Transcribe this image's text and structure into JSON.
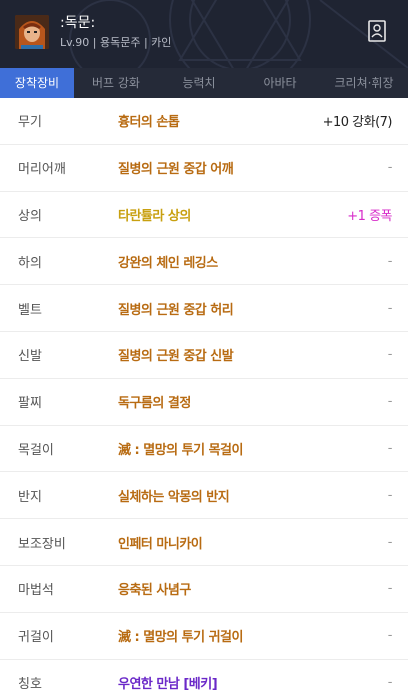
{
  "header": {
    "character_name": ":독문:",
    "character_info": "Lv.90 | 용독문주 | 카인",
    "profile_icon": "profile-card-icon",
    "avatar_icon": "character-portrait"
  },
  "tabs": [
    {
      "label": "장착장비",
      "active": true
    },
    {
      "label": "버프 강화",
      "active": false
    },
    {
      "label": "능력치",
      "active": false
    },
    {
      "label": "아바타",
      "active": false
    },
    {
      "label": "크리쳐·휘장",
      "active": false
    }
  ],
  "colors": {
    "unique": "#b86b12",
    "rare": "#c8a010",
    "epic": "#6a28c8",
    "amp": "#d72bc9",
    "enhance": "#222222",
    "dash": "#999999"
  },
  "equipment": [
    {
      "slot": "무기",
      "item": "흉터의 손톱",
      "extra": "+10 강화(7)",
      "item_color": "#b86b12",
      "extra_color": "#222222"
    },
    {
      "slot": "머리어깨",
      "item": "질병의 근원 중갑 어깨",
      "extra": "-",
      "item_color": "#b86b12",
      "extra_color": "#999999"
    },
    {
      "slot": "상의",
      "item": "타란튤라 상의",
      "extra": "+1 증폭",
      "item_color": "#c8a010",
      "extra_color": "#d72bc9"
    },
    {
      "slot": "하의",
      "item": "강완의 체인 레깅스",
      "extra": "-",
      "item_color": "#b86b12",
      "extra_color": "#999999"
    },
    {
      "slot": "벨트",
      "item": "질병의 근원 중갑 허리",
      "extra": "-",
      "item_color": "#b86b12",
      "extra_color": "#999999"
    },
    {
      "slot": "신발",
      "item": "질병의 근원 중갑 신발",
      "extra": "-",
      "item_color": "#b86b12",
      "extra_color": "#999999"
    },
    {
      "slot": "팔찌",
      "item": "독구름의 결정",
      "extra": "-",
      "item_color": "#b86b12",
      "extra_color": "#999999"
    },
    {
      "slot": "목걸이",
      "item": "滅 : 멸망의 투기 목걸이",
      "extra": "-",
      "item_color": "#b86b12",
      "extra_color": "#999999"
    },
    {
      "slot": "반지",
      "item": "실체하는 악몽의 반지",
      "extra": "-",
      "item_color": "#b86b12",
      "extra_color": "#999999"
    },
    {
      "slot": "보조장비",
      "item": "인페터 마니카이",
      "extra": "-",
      "item_color": "#b86b12",
      "extra_color": "#999999"
    },
    {
      "slot": "마법석",
      "item": "응축된 사념구",
      "extra": "-",
      "item_color": "#b86b12",
      "extra_color": "#999999"
    },
    {
      "slot": "귀걸이",
      "item": "滅 : 멸망의 투기 귀걸이",
      "extra": "-",
      "item_color": "#b86b12",
      "extra_color": "#999999"
    },
    {
      "slot": "칭호",
      "item": "우연한 만남 [베키]",
      "extra": "-",
      "item_color": "#6a28c8",
      "extra_color": "#999999"
    }
  ]
}
